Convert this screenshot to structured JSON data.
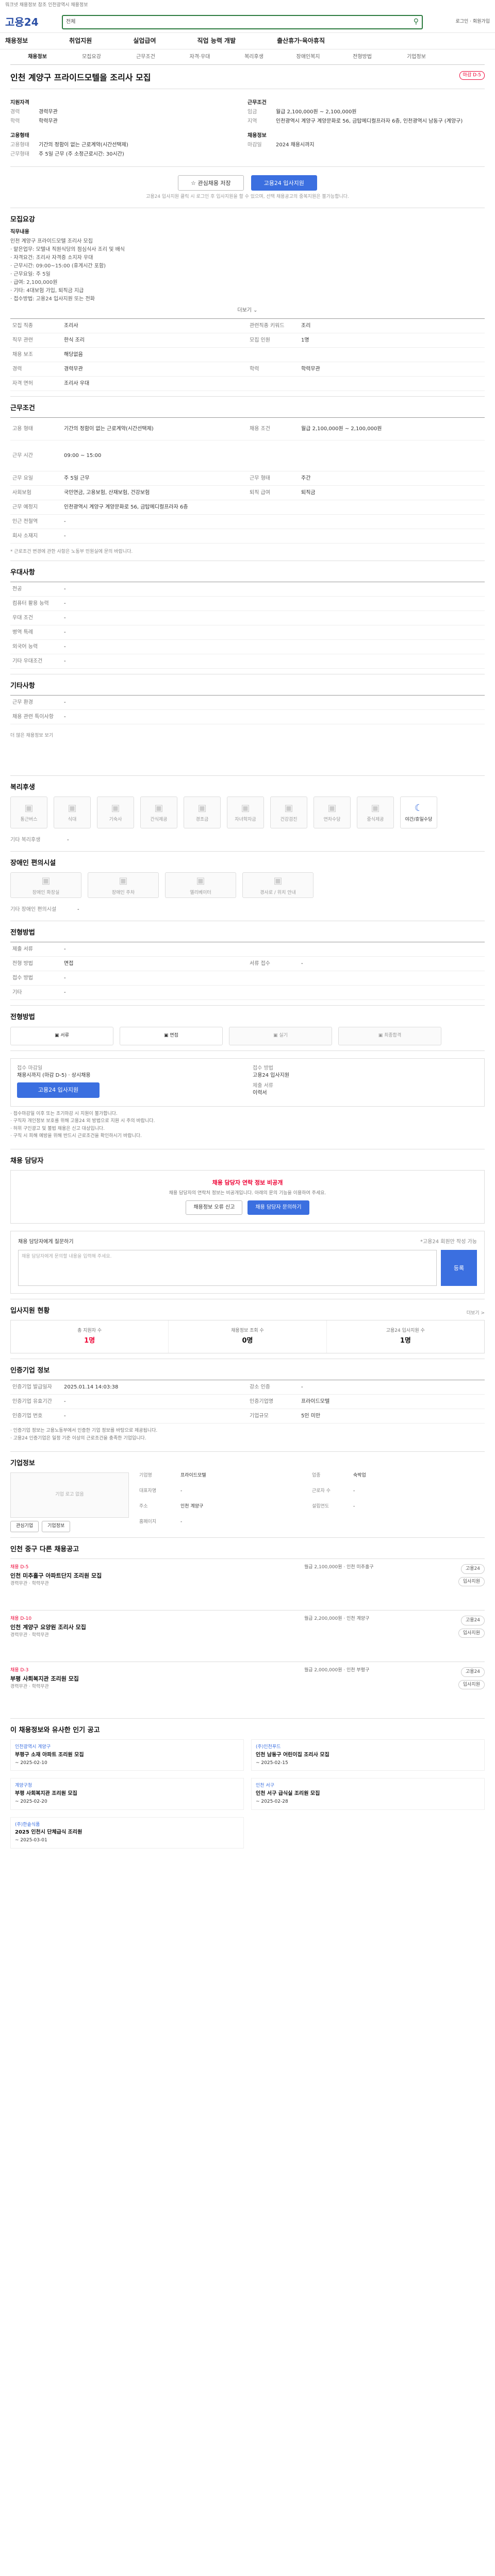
{
  "topbar": {
    "left": "워크넷 채용정보 참조 인천광역시 채용정보",
    "right": ""
  },
  "header": {
    "logo": "고용24",
    "search_type": "전체",
    "search_placeholder": "",
    "login": "로그인 · 회원가입"
  },
  "menu": [
    "채용정보",
    "취업지원",
    "실업급여",
    "직업 능력 개발",
    "출산휴가·육아휴직"
  ],
  "tabs": [
    "채용정보",
    "모집요강",
    "근무조건",
    "자격·우대",
    "복리후생",
    "장애인복지",
    "전형방법",
    "기업정보"
  ],
  "job": {
    "org": "",
    "title": "인천 계양구 프라이드모텔을 조리사 모집",
    "badge": "마감 D-5"
  },
  "summary": {
    "left_label": "지원자격",
    "left": [
      {
        "k": "경력",
        "v": "경력무관"
      },
      {
        "k": "학력",
        "v": "학력무관"
      }
    ],
    "left2_label": "고용형태",
    "left2": [
      {
        "k": "고용형태",
        "v": "기간의 정함이 없는 근로계약(시간선택제)"
      },
      {
        "k": "근무형태",
        "v": "주 5일 근무 (주 소정근로시간: 30시간)"
      }
    ],
    "right_label": "근무조건",
    "right": [
      {
        "k": "임금",
        "v": "월급 2,100,000원 ~ 2,100,000원"
      },
      {
        "k": "지역",
        "v": "인천광역시 계양구 계양문화로 56, 금탑메디컬프라자 6층, 인천광역시 남동구 (계양구)"
      }
    ],
    "right2_label": "채용정보",
    "right2": [
      {
        "k": "마감일",
        "v": "2024 채용시까지"
      }
    ]
  },
  "actions": {
    "save": "관심채용 저장",
    "apply": "고용24 입사지원"
  },
  "note": "고용24 입사지원 클릭 시 로그인 후 입사지원을 할 수 있으며, 선택 채용공고의 중복지원은 불가능합니다.",
  "sections": {
    "recruit": {
      "title": "모집요강",
      "sub1": "직무내용",
      "items": [
        "인천 계양구 프라이드모텔 조리사 모집",
        "· 맡은업무: 모텔내 직원식당의 점심식사 조리 및 배식",
        "· 자격요건: 조리사 자격증 소지자 우대",
        "· 근무시간: 09:00~15:00 (휴게시간 포함)",
        "· 근무요일: 주 5일",
        "· 급여: 2,100,000원",
        "· 기타: 4대보험 가입, 퇴직금 지급",
        "· 접수방법: 고용24 입사지원 또는 전화"
      ],
      "more": "더보기 ⌄",
      "rows": [
        {
          "k": "모집 직종",
          "v": "조리사",
          "k2": "관련직종 키워드",
          "v2": "조리"
        },
        {
          "k": "직무 관련",
          "v": "한식 조리",
          "k2": "모집 인원",
          "v2": "1명"
        },
        {
          "k": "채용 보조",
          "v": "해당없음",
          "k2": "",
          "v2": ""
        },
        {
          "k": "경력",
          "v": "경력무관",
          "k2": "학력",
          "v2": "학력무관"
        },
        {
          "k": "자격 면허",
          "v": "조리사 우대",
          "k2": "",
          "v2": ""
        }
      ]
    },
    "cond": {
      "title": "근무조건",
      "rows": [
        {
          "k": "고용 형태",
          "v": "기간의 정함이 없는 근로계약(시간선택제)",
          "k2": "채용 조건",
          "v2": "월급 2,100,000원 ~ 2,100,000원"
        },
        {
          "k": "근무 시간",
          "v": "09:00 ~ 15:00",
          "k2": "",
          "v2": ""
        },
        {
          "k": "근무 요일",
          "v": "주 5일 근무",
          "k2": "근무 형태",
          "v2": "주간"
        },
        {
          "k": "사회보험",
          "v": "국민연금, 고용보험, 산재보험, 건강보험",
          "k2": "퇴직 급여",
          "v2": "퇴직금"
        },
        {
          "k": "근무 예정지",
          "v": "인천광역시 계양구 계양문화로 56, 금탑메디컬프라자 6층",
          "k2": "",
          "v2": ""
        },
        {
          "k": "인근 전철역",
          "v": "-",
          "k2": "",
          "v2": ""
        },
        {
          "k": "회사 소재지",
          "v": "-",
          "k2": "",
          "v2": ""
        }
      ],
      "foot": "* 근로조건 변경에 관한 사항은 노동부 민원실에 문의 바랍니다."
    },
    "pref": {
      "title": "우대사항",
      "rows": [
        {
          "k": "전공",
          "v": "-"
        },
        {
          "k": "컴퓨터 활용 능력",
          "v": "-"
        },
        {
          "k": "우대 조건",
          "v": "-"
        },
        {
          "k": "병역 특례",
          "v": "-"
        },
        {
          "k": "외국어 능력",
          "v": "-"
        },
        {
          "k": "기타 우대조건",
          "v": "-"
        }
      ]
    },
    "etc": {
      "title": "기타사항",
      "rows": [
        {
          "k": "근무 환경",
          "v": "-"
        },
        {
          "k": "채용 관련 특이사항",
          "v": "-"
        }
      ],
      "more": "더 많은 채용정보 보기"
    },
    "welfare": {
      "title": "복리후생",
      "icons": [
        "통근버스",
        "식대",
        "기숙사",
        "간식제공",
        "경조금",
        "자녀학자금",
        "건강검진",
        "연차수당",
        "중식제공",
        "야간/휴일수당"
      ],
      "sub": "기타 복리후생",
      "sub_v": "-"
    },
    "disabled": {
      "title": "장애인 편의시설",
      "icons": [
        "장애인 화장실",
        "장애인 주차",
        "엘리베이터",
        "경사로 / 위치 안내"
      ],
      "sub": "기타 장애인 편의시설",
      "sub_v": "-"
    },
    "select": {
      "title": "전형방법",
      "rows": [
        {
          "k": "제출 서류",
          "v": "-",
          "k2": "",
          "v2": ""
        },
        {
          "k": "전형 방법",
          "v": "면접",
          "k2": "서류 접수",
          "v2": "-"
        },
        {
          "k": "접수 방법",
          "v": "-",
          "k2": "",
          "v2": ""
        },
        {
          "k": "기타",
          "v": "-",
          "k2": "",
          "v2": ""
        }
      ]
    },
    "steps": {
      "title": "전형방법",
      "items": [
        "서류",
        "면접",
        "실기",
        "최종합격"
      ]
    },
    "apply": {
      "l1": "접수 마감일",
      "v1": "채용시까지 (마감 D-5) · 상시채용",
      "l2": "접수 방법",
      "v2": "고용24 입사지원",
      "l3": "제출 서류",
      "v3": "이력서",
      "button": "고용24 입사지원"
    },
    "notices": [
      "· 접수마감일 이후 또는 조기마감 시 지원이 불가합니다.",
      "· 구직자 개인정보 보호를 위해 고용24 외 방법으로 지원 시 주의 바랍니다.",
      "· 허위 구인광고 및 불법 채용은 신고 대상입니다.",
      "· 구직 시 피해 예방을 위해 반드시 근로조건을 확인하시기 바랍니다."
    ],
    "qna": {
      "title": "채용 담당자",
      "warn": "채용 담당자 연락 정보 비공개",
      "p": "채용 담당자의 연락처 정보는 비공개입니다. 아래의 문의 기능을 이용하여 주세요.",
      "b1": "채용정보 오류 신고",
      "b2": "채용 담당자 문의하기",
      "form_title": "채용 담당자에게 질문하기",
      "form_right": "*고용24 회원만 작성 가능",
      "area": "채용 담당자에게 문의할 내용을 입력해 주세요.",
      "reg": "등록"
    },
    "stats": {
      "title": "입사지원 현황",
      "link": "더보기 >",
      "items": [
        {
          "n": "총 지원자 수",
          "v": "1명"
        },
        {
          "n": "채용정보 조회 수",
          "v": "0명"
        },
        {
          "n": "고용24 입사지원 수",
          "v": "1명"
        }
      ]
    },
    "info": {
      "title": "인증기업 정보",
      "rows": [
        {
          "k": "인증기업 발급일자",
          "v": "2025.01.14 14:03:38",
          "k2": "강소 인증",
          "v2": "-"
        },
        {
          "k": "인증기업 유효기간",
          "v": "-",
          "k2": "인증기업명",
          "v2": "프라이드모텔"
        },
        {
          "k": "인증기업 번호",
          "v": "-",
          "k2": "기업규모",
          "v2": "5인 미만"
        }
      ],
      "notes": [
        "· 인증기업 정보는 고용노동부에서 인증한 기업 정보를 바탕으로 제공됩니다.",
        "· 고용24 인증기업은 일정 기준 이상의 근로조건을 충족한 기업입니다."
      ]
    },
    "corp": {
      "title": "기업정보",
      "logo": "기업 로고 없음",
      "rows": [
        {
          "k": "기업명",
          "v": "프라이드모텔",
          "k2": "업종",
          "v2": "숙박업"
        },
        {
          "k": "대표자명",
          "v": "-",
          "k2": "근로자 수",
          "v2": "-"
        },
        {
          "k": "주소",
          "v": "인천 계양구",
          "k2": "설립연도",
          "v2": "-"
        },
        {
          "k": "홈페이지",
          "v": "-",
          "k2": "",
          "v2": ""
        }
      ],
      "b1": "관심기업",
      "b2": "기업정보"
    },
    "related": {
      "title": "인천 중구 다른 채용공고",
      "items": [
        {
          "cat": "채용 D-5",
          "name": "인천 미추홀구 아파트단지 조리원 모집",
          "meta": "경력무관 · 학력무관",
          "mid": "월급 2,100,000원 · 인천 미추홀구",
          "r1": "고용24",
          "r2": "입사지원"
        },
        {
          "cat": "채용 D-10",
          "name": "인천 계양구 요양원 조리사 모집",
          "meta": "경력무관 · 학력무관",
          "mid": "월급 2,200,000원 · 인천 계양구",
          "r1": "고용24",
          "r2": "입사지원"
        },
        {
          "cat": "채용 D-3",
          "name": "부평 사회복지관 조리원 모집",
          "meta": "경력무관 · 학력무관",
          "mid": "월급 2,000,000원 · 인천 부평구",
          "r1": "고용24",
          "r2": "입사지원"
        }
      ]
    },
    "popular": {
      "title": "이 채용정보와 유사한 인기 공고",
      "items": [
        {
          "o": "인천광역시 계양구",
          "t": "부평구 소재 아파트 조리원 모집",
          "d": "~ 2025-02-10"
        },
        {
          "o": "(주)인천푸드",
          "t": "인천 남동구 어린이집 조리사 모집",
          "d": "~ 2025-02-15"
        },
        {
          "o": "계양구청",
          "t": "부평 사회복지관 조리원 모집",
          "d": "~ 2025-02-20"
        },
        {
          "o": "인천 서구",
          "t": "인천 서구 급식실 조리원 모집",
          "d": "~ 2025-02-28"
        },
        {
          "o": "(주)한솥식품",
          "t": "2025 인천시 단체급식 조리원",
          "d": "~ 2025-03-01"
        },
        {
          "o": "",
          "t": "",
          "d": ""
        }
      ]
    }
  }
}
